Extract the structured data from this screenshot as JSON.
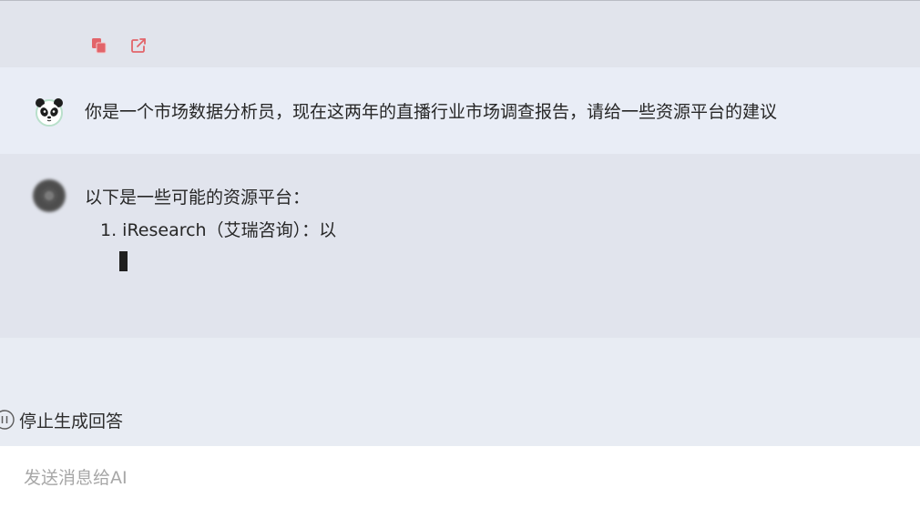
{
  "previous_message": {
    "truncated_text": "",
    "actions": [
      {
        "name": "copy",
        "icon": "copy-icon"
      },
      {
        "name": "open-external",
        "icon": "external-link-icon"
      }
    ]
  },
  "conversation": {
    "user_message": {
      "avatar_icon": "panda-avatar-icon",
      "text": "你是一个市场数据分析员，现在这两年的直播行业市场调查报告，请给一些资源平台的建议"
    },
    "ai_message": {
      "avatar_icon": "ai-avatar-icon",
      "intro": "以下是一些可能的资源平台：",
      "list_items": [
        "1. iResearch（艾瑞咨询）：以"
      ],
      "streaming_cursor": true
    }
  },
  "controls": {
    "stop_label": "停止生成回答",
    "stop_icon": "pause-circle-icon"
  },
  "input": {
    "placeholder": "发送消息给AI",
    "value": ""
  },
  "colors": {
    "accent_icon": "#e2646a",
    "user_bg": "#e9edf6",
    "ai_bg": "#e1e4ed",
    "input_bg": "#ffffff"
  }
}
